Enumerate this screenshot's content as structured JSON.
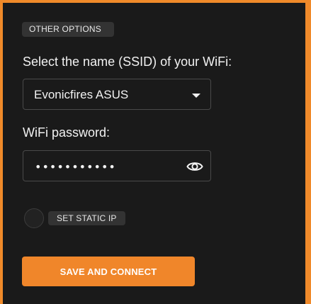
{
  "other_options_label": "OTHER OPTIONS",
  "ssid": {
    "label": "Select the name (SSID) of your WiFi:",
    "selected": "Evonicfires ASUS",
    "icon": "chevron-down-icon"
  },
  "password": {
    "label": "WiFi password:",
    "value": "•••••••••••",
    "toggle_icon": "eye-icon"
  },
  "static_ip": {
    "label": "SET STATIC IP",
    "checked": false
  },
  "submit_label": "SAVE AND CONNECT",
  "colors": {
    "accent": "#f0862a",
    "panel": "#1a1a1a",
    "text": "#f2f2f2",
    "chip": "#333333"
  }
}
